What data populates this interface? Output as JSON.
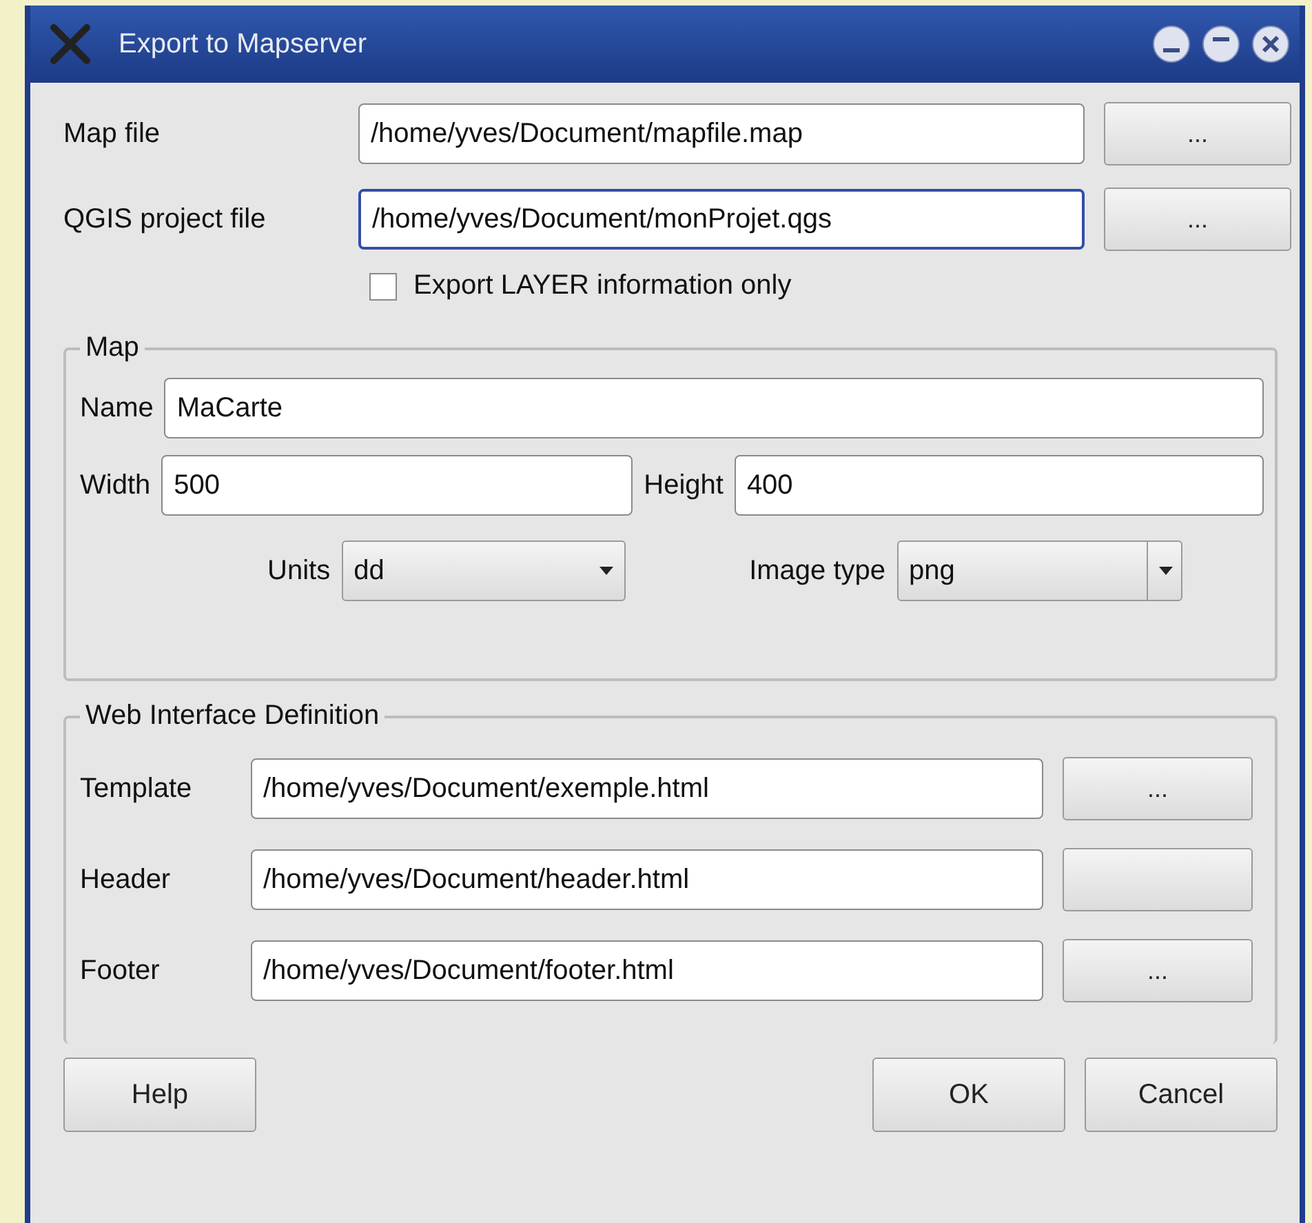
{
  "window": {
    "title": "Export to Mapserver"
  },
  "files": [
    {
      "label": "Map file",
      "value": "/home/yves/Document/mapfile.map",
      "focused": false,
      "button": "..."
    },
    {
      "label": "QGIS project file",
      "value": "/home/yves/Document/monProjet.qgs",
      "focused": true,
      "button": "..."
    }
  ],
  "export_layer_only": {
    "label": "Export LAYER information only",
    "checked": false
  },
  "map": {
    "title": "Map",
    "name": {
      "label": "Name",
      "value": "MaCarte"
    },
    "width": {
      "label": "Width",
      "value": "500"
    },
    "height": {
      "label": "Height",
      "value": "400"
    },
    "units": {
      "label": "Units",
      "value": "dd"
    },
    "image_type": {
      "label": "Image type",
      "value": "png"
    }
  },
  "web": {
    "title": "Web Interface Definition",
    "rows": [
      {
        "label": "Template",
        "value": "/home/yves/Document/exemple.html",
        "button": "..."
      },
      {
        "label": "Header",
        "value": "/home/yves/Document/header.html"
      },
      {
        "label": "Footer",
        "value": "/home/yves/Document/footer.html",
        "button": "..."
      }
    ]
  },
  "help_button": "Help",
  "buttons": [
    "OK",
    "Cancel"
  ]
}
